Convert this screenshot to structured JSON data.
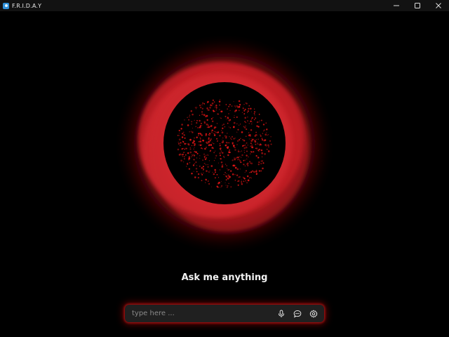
{
  "window": {
    "title": "F.R.I.D.A.Y",
    "controls": [
      "minimize",
      "maximize",
      "close"
    ]
  },
  "main": {
    "prompt": "Ask me anything"
  },
  "input": {
    "placeholder": "type here ...",
    "value": "",
    "icons": [
      "microphone-icon",
      "chat-icon",
      "settings-icon"
    ]
  },
  "colors": {
    "background": "#000000",
    "accent": "#c8181c",
    "particles": "#e01515",
    "inputBackground": "#202020"
  }
}
